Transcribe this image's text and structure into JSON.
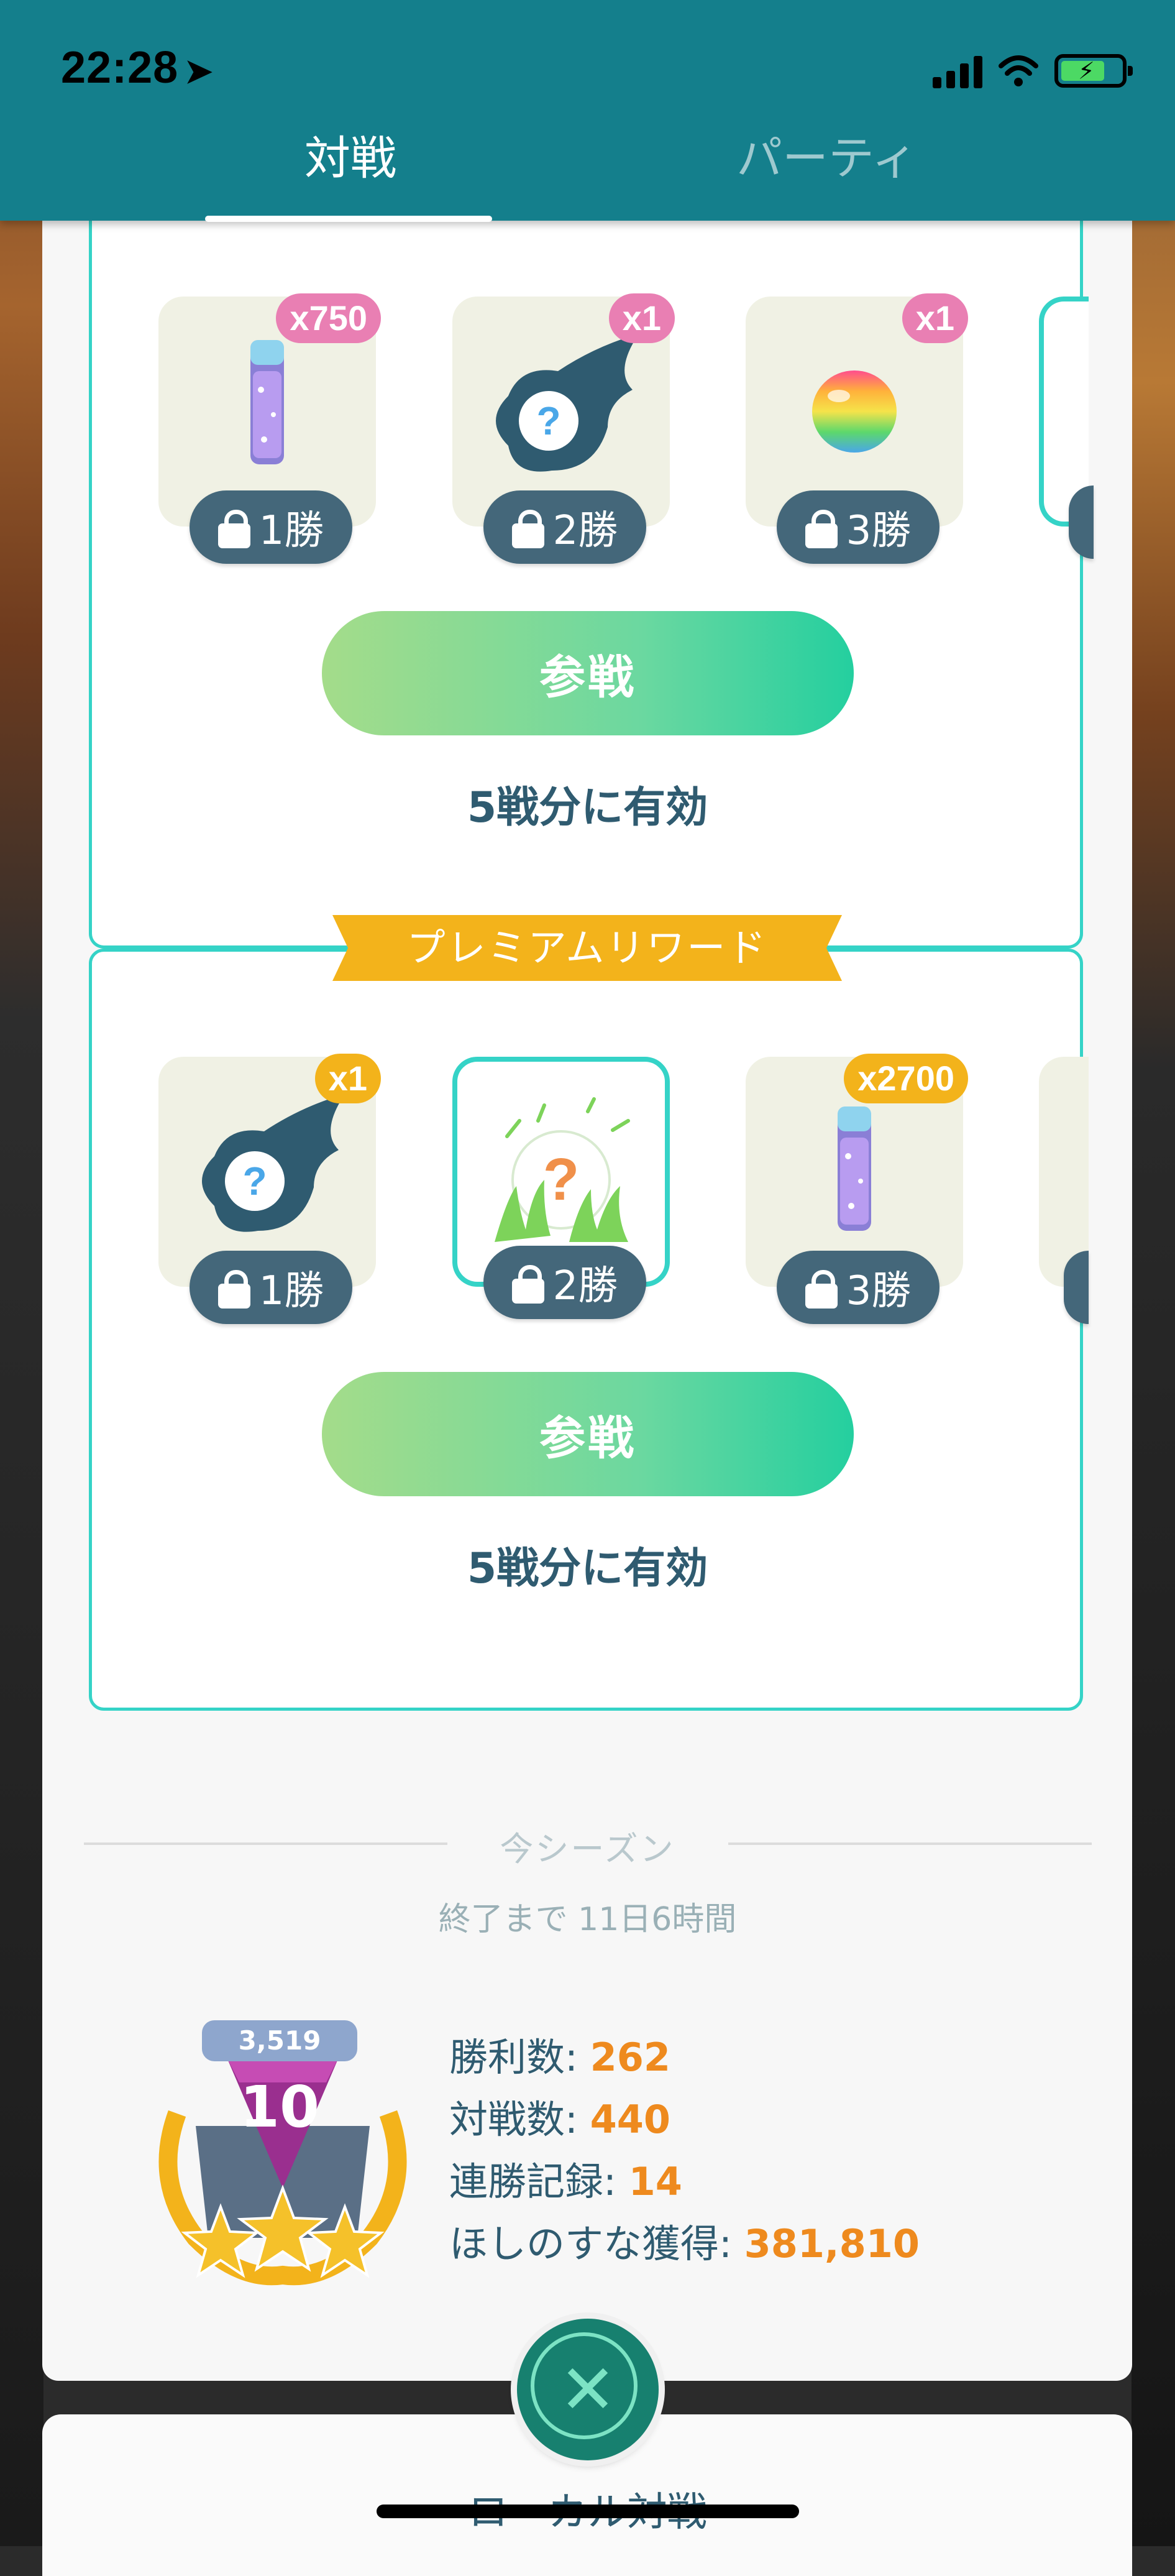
{
  "status_bar": {
    "time": "22:28"
  },
  "tabs": [
    {
      "label": "対戦",
      "active": true
    },
    {
      "label": "パーティ",
      "active": false
    }
  ],
  "free_rewards": {
    "items": [
      {
        "icon": "stardust-icon",
        "qty": "x750",
        "wins": "1勝"
      },
      {
        "icon": "mystery-pokemon-encounter-icon",
        "qty": "x1",
        "wins": "2勝"
      },
      {
        "icon": "rainbow-candy-icon",
        "qty": "x1",
        "wins": "3勝"
      }
    ],
    "join_button": "参戦",
    "valid_text": "5戦分に有効"
  },
  "premium_rewards": {
    "banner": "プレミアムリワード",
    "items": [
      {
        "icon": "mystery-pokemon-encounter-icon",
        "qty": "x1",
        "wins": "1勝"
      },
      {
        "icon": "grass-encounter-icon",
        "qty": "",
        "wins": "2勝"
      },
      {
        "icon": "stardust-icon",
        "qty": "x2700",
        "wins": "3勝"
      }
    ],
    "join_button": "参戦",
    "valid_text": "5戦分に有効"
  },
  "season": {
    "title": "今シーズン",
    "ends_in": "終了まで 11日6時間",
    "rating": "3,519",
    "rank": "10",
    "stars": 3,
    "stats": [
      {
        "label": "勝利数: ",
        "value": "262"
      },
      {
        "label": "対戦数: ",
        "value": "440"
      },
      {
        "label": "連勝記録: ",
        "value": "14"
      },
      {
        "label": "ほしのすな獲得: ",
        "value": "381,810"
      }
    ]
  },
  "bottom_panel": {
    "label": "ローカル対戦"
  },
  "colors": {
    "header_teal": "#147f8c",
    "card_border": "#35d3c7",
    "pink_badge": "#e97fb3",
    "gold_badge": "#f3b31b",
    "stat_value_orange": "#ee8a1e",
    "text_dark": "#2f5b70"
  }
}
